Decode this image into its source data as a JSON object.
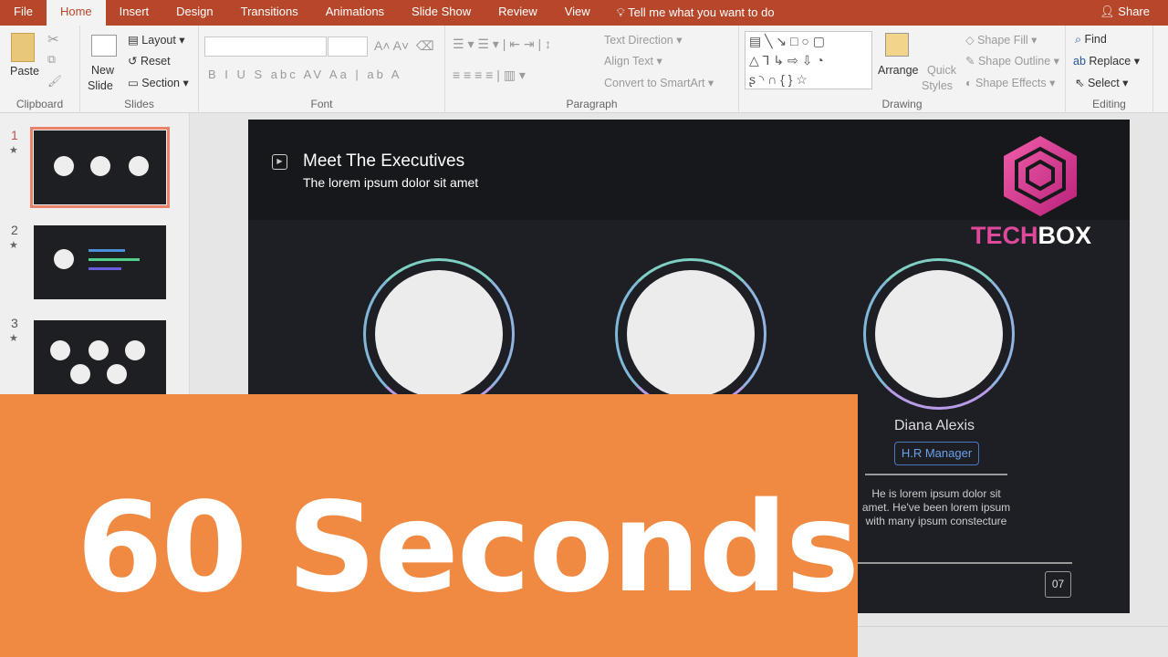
{
  "tabs": [
    "File",
    "Home",
    "Insert",
    "Design",
    "Transitions",
    "Animations",
    "Slide Show",
    "Review",
    "View"
  ],
  "tell_me": "Tell me what you want to do",
  "share": "Share",
  "ribbon": {
    "clipboard": {
      "label": "Clipboard",
      "paste": "Paste"
    },
    "slides": {
      "label": "Slides",
      "new_slide": "New",
      "new_slide2": "Slide",
      "layout": "Layout",
      "reset": "Reset",
      "section": "Section"
    },
    "font": {
      "label": "Font",
      "font_name": "",
      "font_size": ""
    },
    "paragraph": {
      "label": "Paragraph",
      "text_direction": "Text Direction",
      "align_text": "Align Text",
      "convert": "Convert to SmartArt"
    },
    "drawing": {
      "label": "Drawing",
      "arrange": "Arrange",
      "quick": "Quick",
      "styles": "Styles",
      "shape_fill": "Shape Fill",
      "shape_outline": "Shape Outline",
      "shape_effects": "Shape Effects"
    },
    "editing": {
      "label": "Editing",
      "find": "Find",
      "replace": "Replace",
      "select": "Select"
    }
  },
  "thumbnails": [
    {
      "num": "1"
    },
    {
      "num": "2"
    },
    {
      "num": "3"
    }
  ],
  "slide": {
    "title": "Meet The Executives",
    "subtitle": "The lorem ipsum dolor sit amet",
    "logo_a": "TECH",
    "logo_b": "BOX",
    "name": "Diana Alexis",
    "role": "H.R Manager",
    "bio": "He is lorem ipsum dolor sit amet. He've been lorem ipsum with many ipsum constecture",
    "page": "07"
  },
  "overlay": {
    "text": "60 Seconds"
  },
  "colors": {
    "titlebar": "#b7472a",
    "overlay": "#f08a42",
    "logo_pink": "#e0489a"
  }
}
